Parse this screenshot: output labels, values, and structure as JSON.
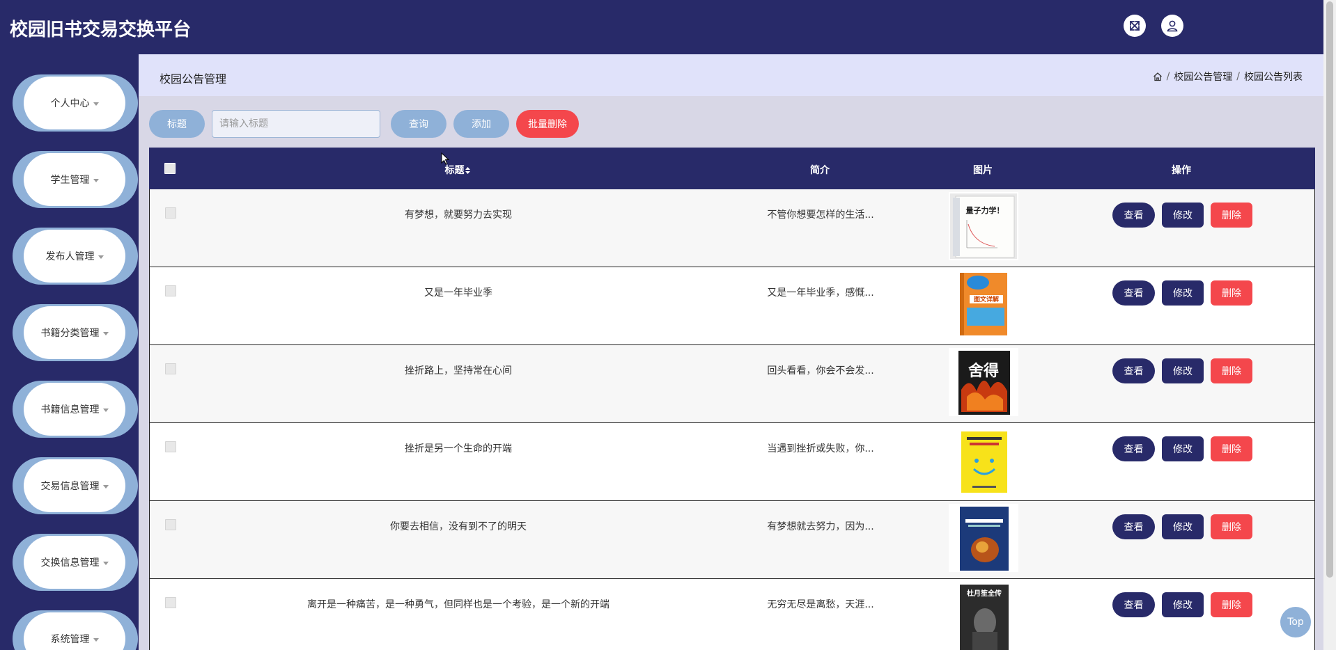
{
  "header": {
    "app_title": "校园旧书交易交换平台"
  },
  "sidebar": {
    "items": [
      {
        "label": "个人中心"
      },
      {
        "label": "学生管理"
      },
      {
        "label": "发布人管理"
      },
      {
        "label": "书籍分类管理"
      },
      {
        "label": "书籍信息管理"
      },
      {
        "label": "交易信息管理"
      },
      {
        "label": "交换信息管理"
      },
      {
        "label": "系统管理"
      }
    ]
  },
  "page": {
    "title": "校园公告管理",
    "breadcrumb": [
      "校园公告管理",
      "校园公告列表"
    ]
  },
  "toolbar": {
    "filter_label": "标题",
    "search_placeholder": "请输入标题",
    "search_value": "",
    "query_label": "查询",
    "add_label": "添加",
    "batch_delete_label": "批量删除"
  },
  "table": {
    "columns": {
      "title": "标题",
      "intro": "简介",
      "image": "图片",
      "action": "操作"
    },
    "actions": {
      "view": "查看",
      "edit": "修改",
      "delete": "删除"
    },
    "rows": [
      {
        "title": "有梦想，就要努力去实现",
        "intro": "不管你想要怎样的生活...",
        "cover_title": "量子力学！"
      },
      {
        "title": "又是一年毕业季",
        "intro": "又是一年毕业季，感慨...",
        "cover_title": "图文详解"
      },
      {
        "title": "挫折路上，坚持常在心间",
        "intro": "回头看看，你会不会发...",
        "cover_title": "舍得"
      },
      {
        "title": "挫折是另一个生命的开端",
        "intro": "当遇到挫折或失败，你...",
        "cover_title": ""
      },
      {
        "title": "你要去相信，没有到不了的明天",
        "intro": "有梦想就去努力，因为...",
        "cover_title": ""
      },
      {
        "title": "离开是一种痛苦，是一种勇气，但同样也是一个考验，是一个新的开端",
        "intro": "无穷无尽是离愁，天涯...",
        "cover_title": "杜月笙全传"
      }
    ]
  },
  "back_to_top": "Top",
  "colors": {
    "navy": "#282a69",
    "light_blue": "#8fb1d8",
    "danger": "#f4474c"
  },
  "icons": {
    "fullscreen": "fullscreen-icon",
    "user": "user-icon",
    "home": "home-icon",
    "sort": "sort-icon"
  }
}
